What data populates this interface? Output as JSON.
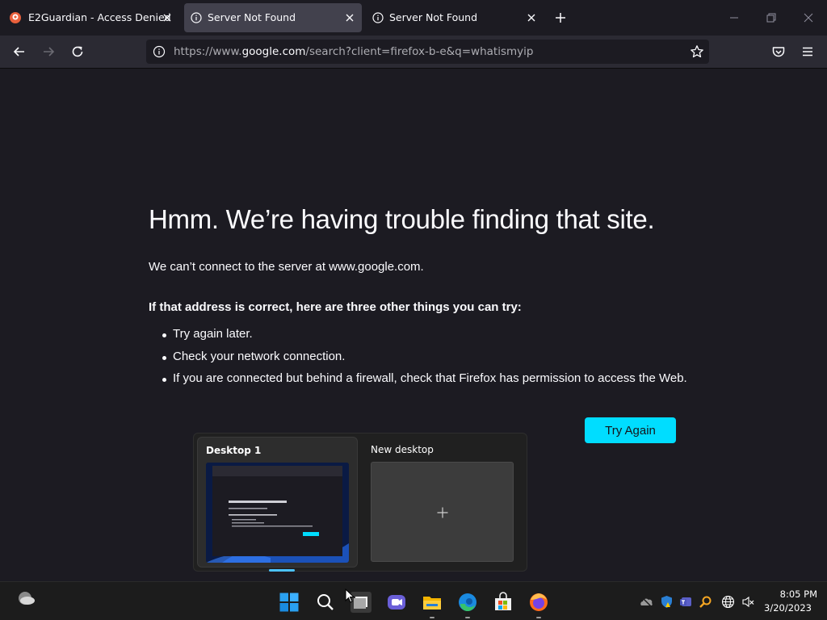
{
  "tabs": [
    {
      "title": "E2Guardian - Access Denied",
      "icon": "e2guardian-icon",
      "active": false
    },
    {
      "title": "Server Not Found",
      "icon": "info-icon",
      "active": true
    },
    {
      "title": "Server Not Found",
      "icon": "info-icon",
      "active": false
    }
  ],
  "navbar": {
    "url_prefix": "https://www.",
    "url_host": "google.com",
    "url_suffix": "/search?client=firefox-b-e&q=whatismyip"
  },
  "error_page": {
    "title": "Hmm. We’re having trouble finding that site.",
    "short_desc": "We can’t connect to the server at www.google.com.",
    "heading": "If that address is correct, here are three other things you can try:",
    "suggestions": [
      "Try again later.",
      "Check your network connection.",
      "If you are connected but behind a firewall, check that Firefox has permission to access the Web."
    ],
    "try_again_label": "Try Again"
  },
  "task_view": {
    "desktops": [
      {
        "label": "Desktop 1",
        "current": true
      },
      {
        "label": "New desktop",
        "current": false
      }
    ]
  },
  "taskbar": {
    "apps": [
      "start-icon",
      "search-icon",
      "task-view-icon",
      "chat-icon",
      "file-explorer-icon",
      "edge-icon",
      "store-icon",
      "firefox-icon"
    ],
    "tray": [
      "onedrive-icon",
      "defender-icon",
      "teams-icon",
      "search-tool-icon",
      "network-icon",
      "volume-muted-icon"
    ],
    "time": "8:05 PM",
    "date": "3/20/2023"
  },
  "colors": {
    "page_bg": "#1c1b22",
    "toolbar_bg": "#2b2a33",
    "active_tab": "#42414d",
    "accent_button": "#00ddff",
    "taskbar_bg": "#1c1c1c",
    "desktop_indicator": "#4cc2ff"
  }
}
